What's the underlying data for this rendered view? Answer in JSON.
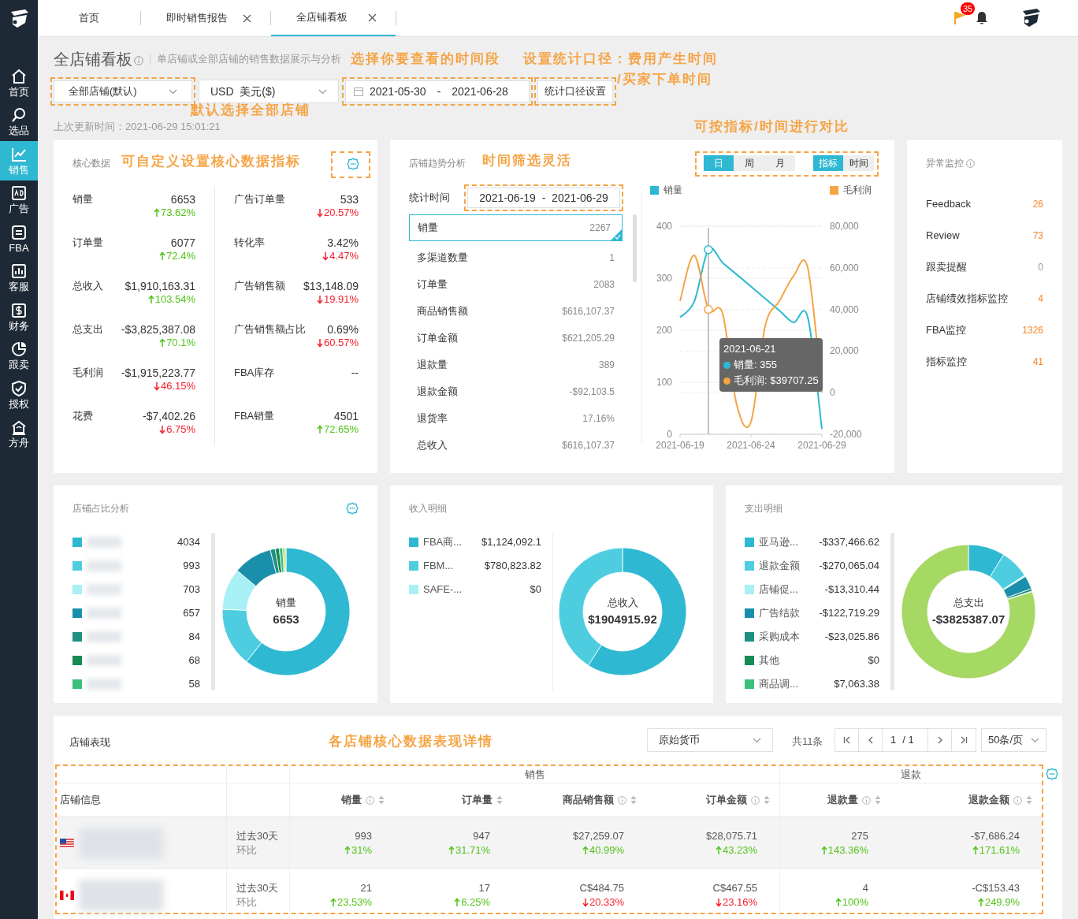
{
  "sidebar": {
    "items": [
      {
        "label": "首页",
        "selected": false
      },
      {
        "label": "选品",
        "selected": false
      },
      {
        "label": "销售",
        "selected": true
      },
      {
        "label": "广告",
        "selected": false
      },
      {
        "label": "FBA",
        "selected": false
      },
      {
        "label": "客服",
        "selected": false
      },
      {
        "label": "财务",
        "selected": false
      },
      {
        "label": "跟卖",
        "selected": false
      },
      {
        "label": "授权",
        "selected": false
      },
      {
        "label": "方舟",
        "selected": false
      }
    ]
  },
  "tabs": [
    {
      "label": "首页",
      "closable": false,
      "selected": false
    },
    {
      "label": "即时销售报告",
      "closable": true,
      "selected": false
    },
    {
      "label": "全店铺看板",
      "closable": true,
      "selected": true
    }
  ],
  "top_bar": {
    "notification_count": "35"
  },
  "header": {
    "title": "全店铺看板",
    "subtitle": "单店铺或全部店铺的销售数据展示与分析",
    "store_select": "全部店铺(默认)",
    "currency_select": "USD  美元($)",
    "date_start": "2021-05-30",
    "date_separator": "-",
    "date_end": "2021-06-28",
    "basis_button": "统计口径设置",
    "last_update": "上次更新时间：2021-06-29 15:01:21"
  },
  "annotations": [
    "选择你要查看的时间段",
    "设置统计口径：费用产生时间",
    "/买家下单时间",
    "默认选择全部店铺",
    "可自定义设置核心数据指标",
    "时间筛选灵活",
    "可按指标/时间进行对比",
    "各店铺核心数据表现详情"
  ],
  "core_data": {
    "title": "核心数据",
    "left": [
      {
        "label": "销量",
        "value": "6653",
        "change": "73.62%",
        "up": true
      },
      {
        "label": "订单量",
        "value": "6077",
        "change": "72.4%",
        "up": true
      },
      {
        "label": "总收入",
        "value": "$1,910,163.31",
        "change": "103.54%",
        "up": true
      },
      {
        "label": "总支出",
        "value": "-$3,825,387.08",
        "change": "70.1%",
        "up": true
      },
      {
        "label": "毛利润",
        "value": "-$1,915,223.77",
        "change": "46.15%",
        "up": false
      },
      {
        "label": "花费",
        "value": "-$7,402.26",
        "change": "6.75%",
        "up": false
      }
    ],
    "right": [
      {
        "label": "广告订单量",
        "value": "533",
        "change": "20.57%",
        "up": false
      },
      {
        "label": "转化率",
        "value": "3.42%",
        "change": "4.47%",
        "up": false
      },
      {
        "label": "广告销售额",
        "value": "$13,148.09",
        "change": "19.91%",
        "up": false
      },
      {
        "label": "广告销售额占比",
        "value": "0.69%",
        "change": "60.57%",
        "up": false
      },
      {
        "label": "FBA库存",
        "value": "--"
      },
      {
        "label": "FBA销量",
        "value": "4501",
        "change": "72.65%",
        "up": true
      }
    ]
  },
  "trend": {
    "title": "店铺趋势分析",
    "period_buttons": [
      {
        "label": "日",
        "selected": true
      },
      {
        "label": "周",
        "selected": false
      },
      {
        "label": "月",
        "selected": false
      }
    ],
    "compare_buttons": [
      {
        "label": "指标",
        "selected": true
      },
      {
        "label": "时间",
        "selected": false
      }
    ],
    "stat_label": "统计时间",
    "date_range": "2021-06-19  -  2021-06-29",
    "metrics": [
      {
        "label": "销量",
        "value": "2267",
        "selected": true
      },
      {
        "label": "多渠道数量",
        "value": "1",
        "selected": false
      },
      {
        "label": "订单量",
        "value": "2083",
        "selected": false
      },
      {
        "label": "商品销售额",
        "value": "$616,107.37",
        "selected": false
      },
      {
        "label": "订单金额",
        "value": "$621,205.29",
        "selected": false
      },
      {
        "label": "退款量",
        "value": "389",
        "selected": false
      },
      {
        "label": "退款金额",
        "value": "-$92,103.5",
        "selected": false
      },
      {
        "label": "退货率",
        "value": "17.16%",
        "selected": false
      },
      {
        "label": "总收入",
        "value": "$616,107.37",
        "selected": false
      }
    ],
    "chart_data": {
      "type": "line",
      "categories": [
        "2021-06-19",
        null,
        null,
        null,
        null,
        "2021-06-24",
        null,
        null,
        null,
        null,
        "2021-06-29"
      ],
      "grid": true,
      "legend": "top",
      "ylim": [
        0,
        400
      ],
      "yticks": [
        0,
        100,
        200,
        300,
        400
      ],
      "y2lim": [
        -20000,
        80000
      ],
      "y2ticks": [
        {
          "value": -20000,
          "label": "-20,000"
        },
        {
          "value": 0,
          "label": "0"
        },
        {
          "value": 20000,
          "label": "20,000"
        },
        {
          "value": 40000,
          "label": "40,000"
        },
        {
          "value": 60000,
          "label": "60,000"
        },
        {
          "value": 80000,
          "label": "80,000"
        }
      ],
      "series": [
        {
          "name": "销量",
          "color": "#2eb8d2",
          "values": [
            225,
            255,
            355,
            330,
            null,
            null,
            null,
            null,
            215,
            225,
            10
          ]
        },
        {
          "name": "毛利润",
          "color": "#f5a445",
          "axis": "y2",
          "values": [
            44000,
            66000,
            40000,
            38000,
            -6000,
            -14000,
            32000,
            null,
            56000,
            60000,
            0
          ]
        }
      ]
    },
    "tooltip": {
      "date": "2021-06-21",
      "lines": [
        "销量: 355",
        "毛利润: $39707.25"
      ]
    }
  },
  "anomaly": {
    "title": "异常监控",
    "items": [
      {
        "label": "Feedback",
        "count": "26",
        "highlight": true
      },
      {
        "label": "Review",
        "count": "73",
        "highlight": true
      },
      {
        "label": "跟卖提醒",
        "count": "0",
        "highlight": false
      },
      {
        "label": "店铺绩效指标监控",
        "count": "4",
        "highlight": true
      },
      {
        "label": "FBA监控",
        "count": "1326",
        "highlight": true
      },
      {
        "label": "指标监控",
        "count": "41",
        "highlight": true
      }
    ]
  },
  "store_share": {
    "title": "店铺占比分析",
    "legend": [
      {
        "color": "#2eb8d2",
        "value": "4034"
      },
      {
        "color": "#4ecde0",
        "value": "993"
      },
      {
        "color": "#a8f0f5",
        "value": "703"
      },
      {
        "color": "#1a8fab",
        "value": "657"
      },
      {
        "color": "#1f9080",
        "value": "84"
      },
      {
        "color": "#188a55",
        "value": "68"
      },
      {
        "color": "#3cbf7a",
        "value": "58"
      }
    ],
    "center_label": "销量",
    "center_value": "6653",
    "chart_data": {
      "type": "donut",
      "values": [
        60.63,
        14.93,
        10.57,
        9.88,
        1.26,
        1.02,
        0.87,
        0.45,
        0.39
      ],
      "colors": [
        "#2eb8d2",
        "#4ecde0",
        "#a8f0f5",
        "#1a8fab",
        "#1f9080",
        "#188a55",
        "#3cbf7a",
        "#7ac943",
        "#d4e157"
      ]
    }
  },
  "income": {
    "title": "收入明细",
    "legend": [
      {
        "color": "#2eb8d2",
        "label": "FBA商...",
        "value": "$1,124,092.1"
      },
      {
        "color": "#4ecde0",
        "label": "FBM...",
        "value": "$780,823.82"
      },
      {
        "color": "#a8f0f5",
        "label": "SAFE-...",
        "value": "$0"
      }
    ],
    "center_label": "总收入",
    "center_value": "$1904915.92",
    "chart_data": {
      "type": "donut",
      "values": [
        59.01,
        40.99,
        0
      ],
      "colors": [
        "#2eb8d2",
        "#4ecde0",
        "#a8f0f5"
      ]
    }
  },
  "expense": {
    "title": "支出明细",
    "legend": [
      {
        "color": "#2eb8d2",
        "label": "亚马逊...",
        "value": "-$337,466.62"
      },
      {
        "color": "#4ecde0",
        "label": "退款金额",
        "value": "-$270,065.04"
      },
      {
        "color": "#a8f0f5",
        "label": "店铺促...",
        "value": "-$13,310.44"
      },
      {
        "color": "#1a8fab",
        "label": "广告结款",
        "value": "-$122,719.29"
      },
      {
        "color": "#1f9080",
        "label": "采购成本",
        "value": "-$23,025.86"
      },
      {
        "color": "#188a55",
        "label": "其他",
        "value": "$0"
      },
      {
        "color": "#3cbf7a",
        "label": "商品调...",
        "value": "$7,063.38"
      }
    ],
    "center_label": "总支出",
    "center_value": "-$3825387.07",
    "chart_data": {
      "type": "donut",
      "values": [
        8.82,
        7.06,
        0.35,
        3.21,
        0.6,
        0,
        0.18,
        79.78
      ],
      "colors": [
        "#2eb8d2",
        "#4ecde0",
        "#a8f0f5",
        "#1a8fab",
        "#1f9080",
        "#188a55",
        "#3cbf7a",
        "#a6d864"
      ]
    }
  },
  "store_table": {
    "title": "店铺表现",
    "currency_select": "原始货币",
    "total": "共11条",
    "page": "1",
    "page_total": "/ 1",
    "page_size": "50条/页",
    "groups": [
      "销售",
      "退款"
    ],
    "columns": [
      "店铺信息",
      "",
      "销量",
      "订单量",
      "商品销售额",
      "订单金额",
      "退款量",
      "退款金额"
    ],
    "rows": [
      {
        "cells": [
          {
            "kind": "usflag"
          },
          {
            "kind": "period",
            "period": "过去30天",
            "compare": "环比"
          },
          {
            "kind": "metric",
            "value": "993",
            "change": "31%",
            "up": true
          },
          {
            "kind": "metric",
            "value": "947",
            "change": "31.71%",
            "up": true
          },
          {
            "kind": "metric",
            "value": "$27,259.07",
            "change": "40.99%",
            "up": true
          },
          {
            "kind": "metric",
            "value": "$28,075.71",
            "change": "43.23%",
            "up": true
          },
          {
            "kind": "metric",
            "value": "275",
            "change": "143.36%",
            "up": true
          },
          {
            "kind": "metric",
            "value": "-$7,686.24",
            "change": "171.61%",
            "up": true
          }
        ]
      },
      {
        "cells": [
          {
            "kind": "caflag"
          },
          {
            "kind": "period",
            "period": "过去30天",
            "compare": "环比"
          },
          {
            "kind": "metric",
            "value": "21",
            "change": "23.53%",
            "up": true
          },
          {
            "kind": "metric",
            "value": "17",
            "change": "6.25%",
            "up": true
          },
          {
            "kind": "metric",
            "value": "C$484.75",
            "change": "20.33%",
            "up": false
          },
          {
            "kind": "metric",
            "value": "C$467.55",
            "change": "23.16%",
            "up": false
          },
          {
            "kind": "metric",
            "value": "4",
            "change": "100%",
            "up": true
          },
          {
            "kind": "metric",
            "value": "-C$153.43",
            "change": "249.9%",
            "up": true
          }
        ]
      }
    ]
  }
}
